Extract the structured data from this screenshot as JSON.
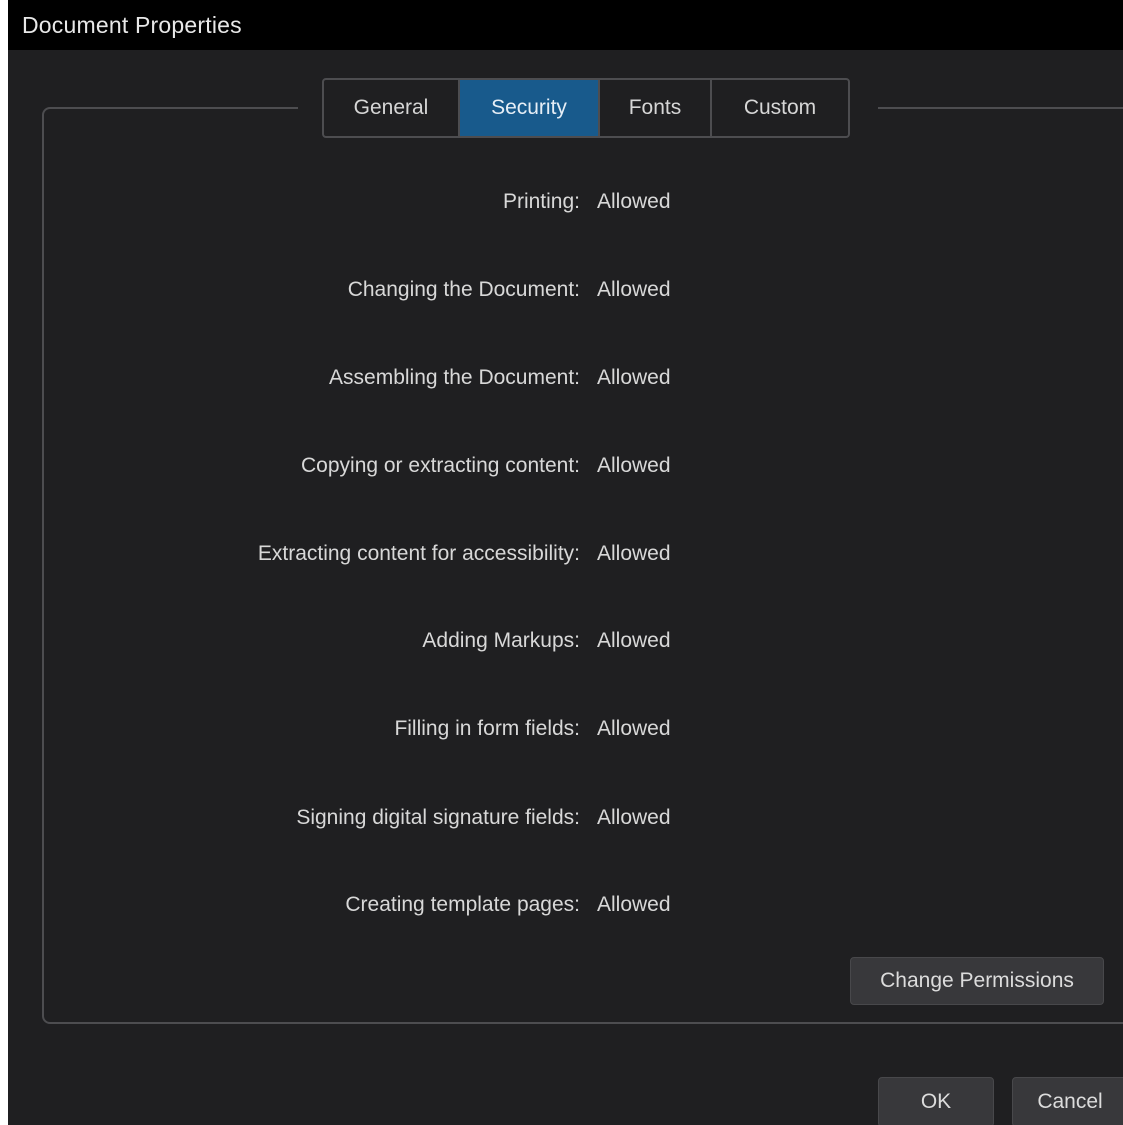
{
  "window": {
    "title": "Document Properties"
  },
  "tabs": [
    {
      "label": "General",
      "active": false
    },
    {
      "label": "Security",
      "active": true
    },
    {
      "label": "Fonts",
      "active": false
    },
    {
      "label": "Custom",
      "active": false
    }
  ],
  "permissions": [
    {
      "label": "Printing:",
      "value": "Allowed"
    },
    {
      "label": "Changing the Document:",
      "value": "Allowed"
    },
    {
      "label": "Assembling the Document:",
      "value": "Allowed"
    },
    {
      "label": "Copying or extracting content:",
      "value": "Allowed"
    },
    {
      "label": "Extracting content for accessibility:",
      "value": "Allowed"
    },
    {
      "label": "Adding Markups:",
      "value": "Allowed"
    },
    {
      "label": "Filling in form fields:",
      "value": "Allowed"
    },
    {
      "label": "Signing digital signature fields:",
      "value": "Allowed"
    },
    {
      "label": "Creating template pages:",
      "value": "Allowed"
    }
  ],
  "buttons": {
    "change_permissions": "Change Permissions",
    "ok": "OK",
    "cancel": "Cancel"
  },
  "colors": {
    "background": "#1f1f21",
    "titlebar": "#000000",
    "active_tab": "#185a8c",
    "border": "#4d4d50",
    "button": "#38383b"
  }
}
